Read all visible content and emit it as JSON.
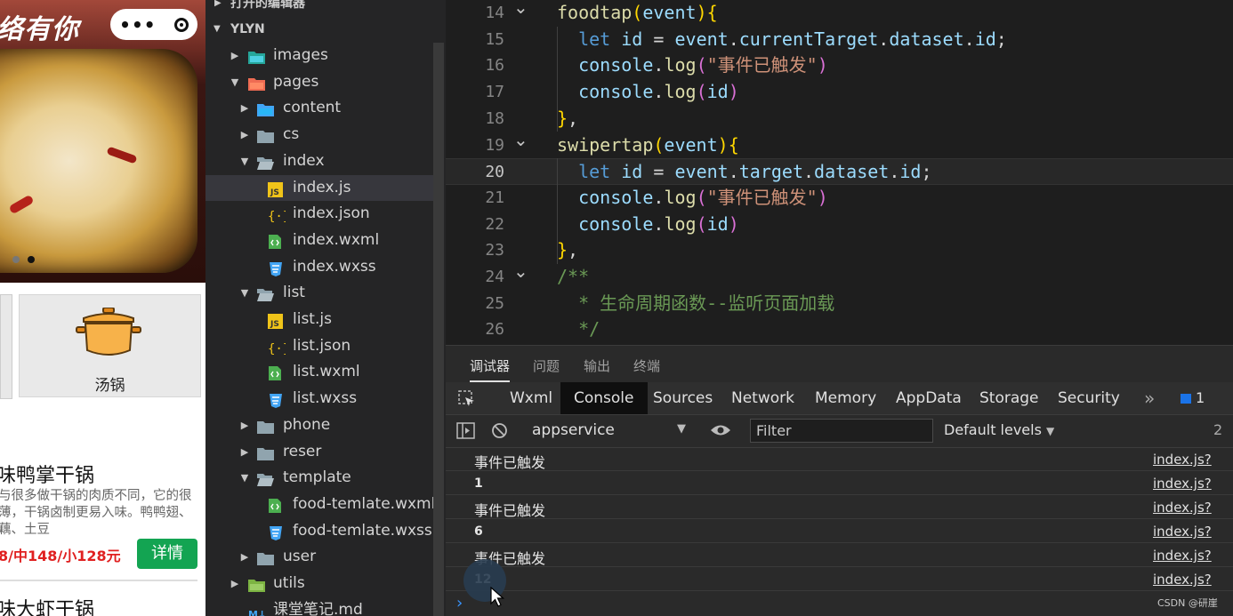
{
  "phone": {
    "slogan": "络有你",
    "capsule": {
      "more_icon": "more-dots-icon",
      "dots": "•••",
      "target_icon": "target-icon"
    },
    "category": {
      "label": "汤锅",
      "icon": "pot-icon"
    },
    "food": {
      "title": "味鸭掌干锅",
      "desc": "与很多做干锅的肉质不同，它的很薄，干锅卤制更易入味。鸭鸭翅、藕、土豆",
      "price": "8/中148/小128元",
      "detail_label": "详情",
      "next_title": "味大虾干锅"
    }
  },
  "explorer": {
    "open_editors": "打开的编辑器",
    "root": "YLYN",
    "tree": [
      {
        "name": "images",
        "type": "folder-img",
        "level": 1,
        "expanded": false
      },
      {
        "name": "pages",
        "type": "folder-pages",
        "level": 1,
        "expanded": true
      },
      {
        "name": "content",
        "type": "folder-blue",
        "level": 2,
        "expanded": false
      },
      {
        "name": "cs",
        "type": "folder",
        "level": 2,
        "expanded": false
      },
      {
        "name": "index",
        "type": "folder-open",
        "level": 2,
        "expanded": true
      },
      {
        "name": "index.js",
        "type": "js",
        "level": 3,
        "selected": true
      },
      {
        "name": "index.json",
        "type": "json",
        "level": 3
      },
      {
        "name": "index.wxml",
        "type": "wxml",
        "level": 3
      },
      {
        "name": "index.wxss",
        "type": "wxss",
        "level": 3
      },
      {
        "name": "list",
        "type": "folder-open",
        "level": 2,
        "expanded": true
      },
      {
        "name": "list.js",
        "type": "js",
        "level": 3
      },
      {
        "name": "list.json",
        "type": "json",
        "level": 3
      },
      {
        "name": "list.wxml",
        "type": "wxml",
        "level": 3
      },
      {
        "name": "list.wxss",
        "type": "wxss",
        "level": 3
      },
      {
        "name": "phone",
        "type": "folder",
        "level": 2,
        "expanded": false
      },
      {
        "name": "reser",
        "type": "folder",
        "level": 2,
        "expanded": false
      },
      {
        "name": "template",
        "type": "folder-open",
        "level": 2,
        "expanded": true
      },
      {
        "name": "food-temlate.wxml",
        "type": "wxml",
        "level": 3
      },
      {
        "name": "food-temlate.wxss",
        "type": "wxss",
        "level": 3
      },
      {
        "name": "user",
        "type": "folder",
        "level": 2,
        "expanded": false
      },
      {
        "name": "utils",
        "type": "folder-green",
        "level": 1,
        "expanded": false
      },
      {
        "name": "课堂笔记.md",
        "type": "md",
        "level": 1
      }
    ]
  },
  "editor": {
    "current_line": "20",
    "lines": [
      {
        "n": "14",
        "fold": true,
        "tokens": [
          [
            "k-fn",
            "foodtap"
          ],
          [
            "k-br1",
            "("
          ],
          [
            "k-var",
            "event"
          ],
          [
            "k-br1",
            ")"
          ],
          [
            "k-br1",
            "{"
          ]
        ]
      },
      {
        "n": "15",
        "tokens": [
          [
            "k-pl",
            "  "
          ],
          [
            "k-kw",
            "let"
          ],
          [
            "k-pl",
            " "
          ],
          [
            "k-var",
            "id"
          ],
          [
            "k-pl",
            " = "
          ],
          [
            "k-var",
            "event"
          ],
          [
            "k-pl",
            "."
          ],
          [
            "k-var",
            "currentTarget"
          ],
          [
            "k-pl",
            "."
          ],
          [
            "k-var",
            "dataset"
          ],
          [
            "k-pl",
            "."
          ],
          [
            "k-var",
            "id"
          ],
          [
            "k-pl",
            ";"
          ]
        ]
      },
      {
        "n": "16",
        "tokens": [
          [
            "k-pl",
            "  "
          ],
          [
            "k-var",
            "console"
          ],
          [
            "k-pl",
            "."
          ],
          [
            "k-fn",
            "log"
          ],
          [
            "k-br2",
            "("
          ],
          [
            "k-str",
            "\"事件已触发\""
          ],
          [
            "k-br2",
            ")"
          ]
        ]
      },
      {
        "n": "17",
        "tokens": [
          [
            "k-pl",
            "  "
          ],
          [
            "k-var",
            "console"
          ],
          [
            "k-pl",
            "."
          ],
          [
            "k-fn",
            "log"
          ],
          [
            "k-br2",
            "("
          ],
          [
            "k-var",
            "id"
          ],
          [
            "k-br2",
            ")"
          ]
        ]
      },
      {
        "n": "18",
        "tokens": [
          [
            "k-br1",
            "}"
          ],
          [
            "k-pl",
            ","
          ]
        ]
      },
      {
        "n": "19",
        "fold": true,
        "tokens": [
          [
            "k-fn",
            "swipertap"
          ],
          [
            "k-br1",
            "("
          ],
          [
            "k-var",
            "event"
          ],
          [
            "k-br1",
            ")"
          ],
          [
            "k-br1",
            "{"
          ]
        ]
      },
      {
        "n": "20",
        "tokens": [
          [
            "k-pl",
            "  "
          ],
          [
            "k-kw",
            "let"
          ],
          [
            "k-pl",
            " "
          ],
          [
            "k-var",
            "id"
          ],
          [
            "k-pl",
            " = "
          ],
          [
            "k-var",
            "event"
          ],
          [
            "k-pl",
            "."
          ],
          [
            "k-var",
            "target"
          ],
          [
            "k-pl",
            "."
          ],
          [
            "k-var",
            "dataset"
          ],
          [
            "k-pl",
            "."
          ],
          [
            "k-var",
            "id"
          ],
          [
            "k-pl",
            ";"
          ]
        ]
      },
      {
        "n": "21",
        "tokens": [
          [
            "k-pl",
            "  "
          ],
          [
            "k-var",
            "console"
          ],
          [
            "k-pl",
            "."
          ],
          [
            "k-fn",
            "log"
          ],
          [
            "k-br2",
            "("
          ],
          [
            "k-str",
            "\"事件已触发\""
          ],
          [
            "k-br2",
            ")"
          ]
        ]
      },
      {
        "n": "22",
        "tokens": [
          [
            "k-pl",
            "  "
          ],
          [
            "k-var",
            "console"
          ],
          [
            "k-pl",
            "."
          ],
          [
            "k-fn",
            "log"
          ],
          [
            "k-br2",
            "("
          ],
          [
            "k-var",
            "id"
          ],
          [
            "k-br2",
            ")"
          ]
        ]
      },
      {
        "n": "23",
        "tokens": [
          [
            "k-br1",
            "}"
          ],
          [
            "k-pl",
            ","
          ]
        ]
      },
      {
        "n": "24",
        "fold": true,
        "tokens": [
          [
            "k-cmt",
            "/**"
          ]
        ]
      },
      {
        "n": "25",
        "tokens": [
          [
            "k-cmt",
            "  * 生命周期函数--监听页面加载"
          ]
        ]
      },
      {
        "n": "26",
        "tokens": [
          [
            "k-cmt",
            "  */"
          ]
        ]
      }
    ]
  },
  "panel": {
    "tabs": [
      "调试器",
      "问题",
      "输出",
      "终端"
    ],
    "active_tab": "调试器",
    "devtools_tabs": [
      "Wxml",
      "Console",
      "Sources",
      "Network",
      "Memory",
      "AppData",
      "Storage",
      "Security"
    ],
    "active_devtool": "Console",
    "more": "»",
    "badge_count": "1",
    "context": "appservice",
    "filter_placeholder": "Filter",
    "levels": "Default levels",
    "row_hint": "2",
    "logs": [
      {
        "msg": "事件已触发",
        "num": false,
        "src": "index.js?"
      },
      {
        "msg": "1",
        "num": true,
        "src": "index.js?"
      },
      {
        "msg": "事件已触发",
        "num": false,
        "src": "index.js?"
      },
      {
        "msg": "6",
        "num": true,
        "src": "index.js?"
      },
      {
        "msg": "事件已触发",
        "num": false,
        "src": "index.js?"
      },
      {
        "msg": "12",
        "num": true,
        "src": "index.js?"
      }
    ],
    "prompt": "›",
    "watermark": "CSDN @研崖"
  }
}
